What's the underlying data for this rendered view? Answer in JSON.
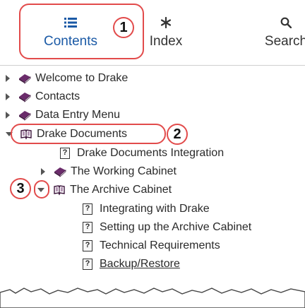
{
  "tabs": [
    {
      "label": "Contents",
      "icon": "list-icon",
      "active": true
    },
    {
      "label": "Index",
      "icon": "asterisk-icon",
      "active": false
    },
    {
      "label": "Search",
      "icon": "search-icon",
      "active": false
    }
  ],
  "callouts": [
    "1",
    "2",
    "3"
  ],
  "tree": {
    "items": [
      {
        "label": "Welcome to Drake",
        "icon": "closed-book-icon",
        "state": "collapsed"
      },
      {
        "label": "Contacts",
        "icon": "closed-book-icon",
        "state": "collapsed"
      },
      {
        "label": "Data Entry Menu",
        "icon": "closed-book-icon",
        "state": "collapsed"
      },
      {
        "label": "Drake Documents",
        "icon": "open-book-icon",
        "state": "expanded"
      },
      {
        "label": "Drake Documents Integration",
        "icon": "help-page-icon",
        "state": "leaf"
      },
      {
        "label": "The Working Cabinet",
        "icon": "closed-book-icon",
        "state": "collapsed"
      },
      {
        "label": "The Archive Cabinet",
        "icon": "open-book-icon",
        "state": "expanded"
      },
      {
        "label": "Integrating with Drake",
        "icon": "help-page-icon",
        "state": "leaf"
      },
      {
        "label": "Setting up the Archive Cabinet",
        "icon": "help-page-icon",
        "state": "leaf"
      },
      {
        "label": "Technical Requirements",
        "icon": "help-page-icon",
        "state": "leaf"
      },
      {
        "label": "Backup/Restore",
        "icon": "help-page-icon",
        "state": "leaf"
      }
    ]
  },
  "colors": {
    "accent": "#1b5aa6",
    "annotation": "#e24b4b",
    "book": "#6b2c6b"
  }
}
